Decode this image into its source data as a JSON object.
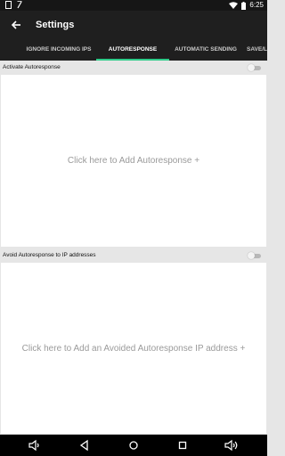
{
  "status_bar": {
    "time": "6:25",
    "icons": [
      "notification-square-icon",
      "sim-icon",
      "wifi-icon",
      "battery-icon"
    ]
  },
  "app_bar": {
    "title": "Settings",
    "back_icon": "arrow-back-icon"
  },
  "tabs": [
    {
      "label": "IGNORE INCOMING IPS",
      "active": false
    },
    {
      "label": "AUTORESPONSE",
      "active": true
    },
    {
      "label": "AUTOMATIC SENDING",
      "active": false
    },
    {
      "label": "SAVE/L",
      "active": false
    }
  ],
  "sections": [
    {
      "label": "Activate Autoresponse",
      "toggle_on": false,
      "panel_text": "Click here to Add Autoresponse +"
    },
    {
      "label": "Avoid Autoresponse to IP addresses",
      "toggle_on": false,
      "panel_text": "Click here to Add an Avoided Autoresponse IP address +"
    }
  ],
  "nav_bar": {
    "icons": [
      "volume-down-icon",
      "back-triangle-icon",
      "home-circle-icon",
      "recents-square-icon",
      "volume-up-icon"
    ]
  },
  "colors": {
    "accent": "#2fcc8a",
    "toolbar": "#1f1f1f",
    "status_bar": "#161616",
    "background": "#e6e6e6",
    "panel": "#ffffff",
    "panel_text": "#9a9a9a"
  }
}
